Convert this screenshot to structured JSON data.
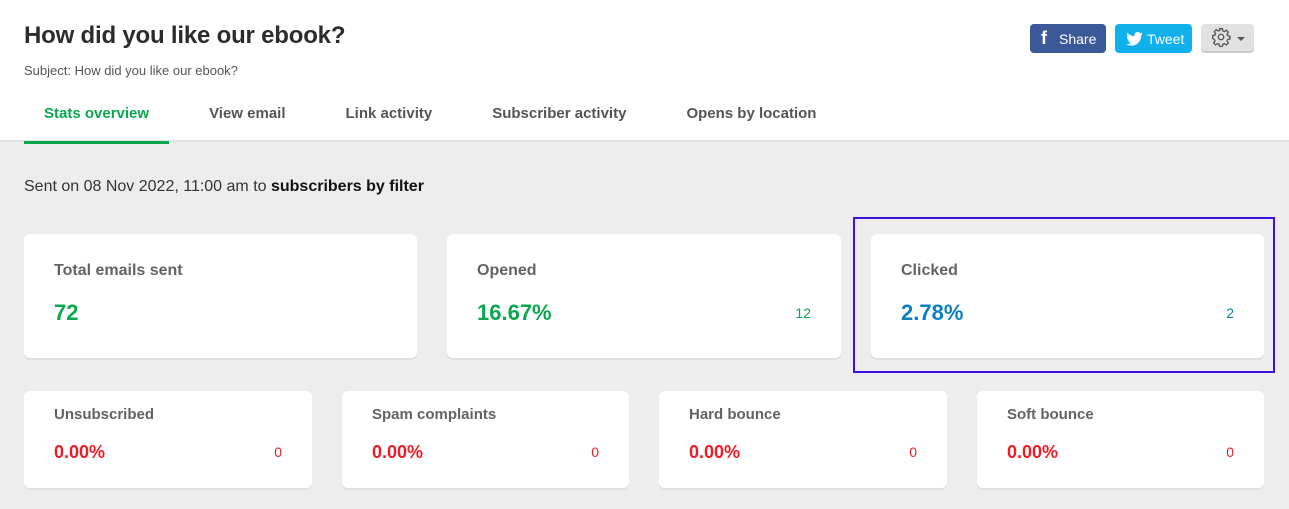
{
  "header": {
    "title": "How did you like our ebook?",
    "subject": "Subject: How did you like our ebook?",
    "share_label": "Share",
    "tweet_label": "Tweet",
    "facebook_icon": "f",
    "settings_icon": "gear-icon"
  },
  "tabs": [
    {
      "label": "Stats overview",
      "active": true
    },
    {
      "label": "View email",
      "active": false
    },
    {
      "label": "Link activity",
      "active": false
    },
    {
      "label": "Subscriber activity",
      "active": false
    },
    {
      "label": "Opens by location",
      "active": false
    }
  ],
  "sent": {
    "prefix": "Sent on 08 Nov 2022, 11:00 am to ",
    "target": "subscribers by filter"
  },
  "stats": {
    "total": {
      "label": "Total emails sent",
      "value": "72"
    },
    "opened": {
      "label": "Opened",
      "percent": "16.67%",
      "count": "12"
    },
    "clicked": {
      "label": "Clicked",
      "percent": "2.78%",
      "count": "2"
    },
    "unsubscribed": {
      "label": "Unsubscribed",
      "percent": "0.00%",
      "count": "0"
    },
    "spam": {
      "label": "Spam complaints",
      "percent": "0.00%",
      "count": "0"
    },
    "hard_bounce": {
      "label": "Hard bounce",
      "percent": "0.00%",
      "count": "0"
    },
    "soft_bounce": {
      "label": "Soft bounce",
      "percent": "0.00%",
      "count": "0"
    }
  },
  "colors": {
    "accent_green": "#09a84f",
    "click_blue": "#0a7fbd",
    "negative_red": "#ee1c24",
    "facebook": "#3b5998",
    "twitter": "#0fb0ec",
    "highlight": "#3a10e5"
  }
}
